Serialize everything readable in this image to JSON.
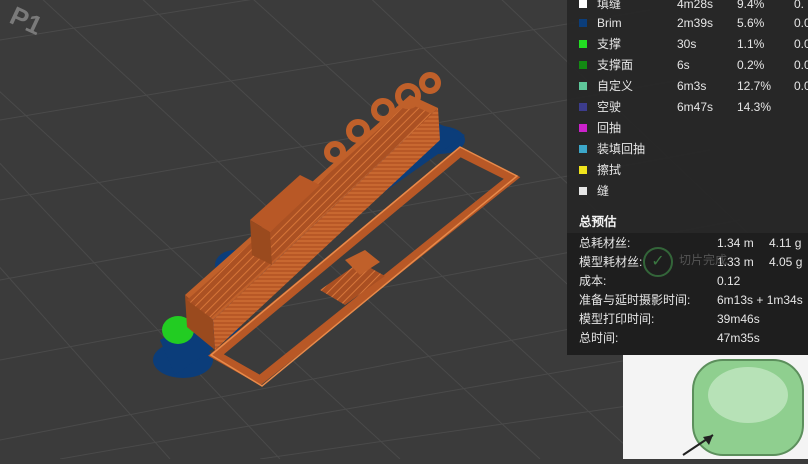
{
  "plate_label": "P1",
  "legend": [
    {
      "label": "填缝",
      "time": "4m28s",
      "percent": "9.4%",
      "extra": "0.",
      "color": "#ffffff"
    },
    {
      "label": "Brim",
      "time": "2m39s",
      "percent": "5.6%",
      "extra": "0.0",
      "color": "#0b3d7a"
    },
    {
      "label": "支撑",
      "time": "30s",
      "percent": "1.1%",
      "extra": "0.0",
      "color": "#22dd22"
    },
    {
      "label": "支撑面",
      "time": "6s",
      "percent": "0.2%",
      "extra": "0.0",
      "color": "#138a13"
    },
    {
      "label": "自定义",
      "time": "6m3s",
      "percent": "12.7%",
      "extra": "0.0",
      "color": "#5ec79a"
    },
    {
      "label": "空驶",
      "time": "6m47s",
      "percent": "14.3%",
      "extra": "",
      "color": "#3c3c8c"
    },
    {
      "label": "回抽",
      "time": "",
      "percent": "",
      "extra": "",
      "color": "#cc22cc"
    },
    {
      "label": "装填回抽",
      "time": "",
      "percent": "",
      "extra": "",
      "color": "#3ca7c9"
    },
    {
      "label": "擦拭",
      "time": "",
      "percent": "",
      "extra": "",
      "color": "#f0e41c"
    },
    {
      "label": "缝",
      "time": "",
      "percent": "",
      "extra": "",
      "color": "#e6e6e6"
    }
  ],
  "estimate": {
    "title": "总预估",
    "rows": [
      {
        "label": "总耗材丝:",
        "v1": "1.34 m",
        "v2": "4.11 g"
      },
      {
        "label": "模型耗材丝:",
        "v1": "1.33 m",
        "v2": "4.05 g"
      },
      {
        "label": "成本:",
        "v1": "0.12",
        "v2": ""
      },
      {
        "label": "准备与延时摄影时间:",
        "v1": "6m13s + 1m34s",
        "v2": ""
      },
      {
        "label": "模型打印时间:",
        "v1": "39m46s",
        "v2": ""
      },
      {
        "label": "总时间:",
        "v1": "47m35s",
        "v2": ""
      }
    ]
  },
  "toast": {
    "text": "切片完成",
    "icon": "check-circle-icon"
  },
  "colors": {
    "model": "#c0602a",
    "brim": "#0b3d7a",
    "support": "#22cc22",
    "bed": "#3b3b3b"
  }
}
